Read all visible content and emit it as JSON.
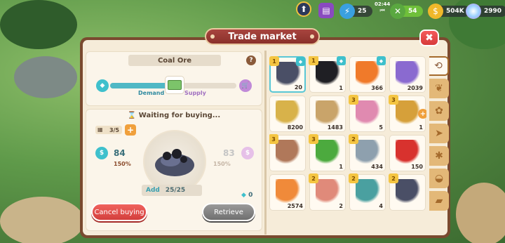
{
  "hud": {
    "level_icon": "rank-icon",
    "energy": "25",
    "timer": "02:44",
    "stamina": "54",
    "coins": "504K",
    "gems": "2990"
  },
  "window": {
    "title": "Trade market",
    "close_icon": "close-icon"
  },
  "item": {
    "name": "Coal Ore",
    "demand_label": "Demand",
    "supply_label": "Supply",
    "demand_supply_balance": 0.5
  },
  "status": {
    "waiting_text": "Waiting for buying...",
    "slots": "3/5",
    "buy_price": "84",
    "buy_pct": "150%",
    "sell_price": "83",
    "sell_pct": "150%",
    "add_label": "Add",
    "add_value": "25/25",
    "cube_count": "0"
  },
  "buttons": {
    "cancel": "Cancel buying",
    "retrieve": "Retrieve"
  },
  "grid": [
    {
      "name": "coal-ore",
      "qty": "20",
      "star": "1",
      "cube": true,
      "selected": true,
      "color": "#4a4f66"
    },
    {
      "name": "coal",
      "qty": "1",
      "star": "1",
      "cube": true,
      "color": "#1f1f24"
    },
    {
      "name": "carrot",
      "qty": "366",
      "star": "",
      "cube": true,
      "color": "#f07a2a"
    },
    {
      "name": "purple-log",
      "qty": "2039",
      "star": "",
      "cube": false,
      "color": "#8a6ad0"
    },
    {
      "name": "corn",
      "qty": "8200",
      "star": "",
      "cube": false,
      "color": "#d8b24a"
    },
    {
      "name": "pinecone",
      "qty": "1483",
      "star": "",
      "cube": false,
      "color": "#c9a46a"
    },
    {
      "name": "pink-flower",
      "qty": "5",
      "star": "3",
      "cube": false,
      "color": "#e08ab0"
    },
    {
      "name": "striped-fish",
      "qty": "1",
      "star": "3",
      "cube": false,
      "plus": true,
      "color": "#d6a03a"
    },
    {
      "name": "moth",
      "qty": "",
      "star": "3",
      "cube": false,
      "color": "#b0785a"
    },
    {
      "name": "green-butterfly",
      "qty": "1",
      "star": "3",
      "cube": false,
      "color": "#4caa3e"
    },
    {
      "name": "grey-fish",
      "qty": "434",
      "star": "2",
      "cube": false,
      "color": "#8ea0ae"
    },
    {
      "name": "apple",
      "qty": "150",
      "star": "",
      "cube": false,
      "color": "#d8322e"
    },
    {
      "name": "carrots",
      "qty": "2574",
      "star": "",
      "cube": false,
      "color": "#f08a3a"
    },
    {
      "name": "red-fish",
      "qty": "2",
      "star": "2",
      "cube": false,
      "color": "#e08a7a"
    },
    {
      "name": "teal-fish",
      "qty": "4",
      "star": "2",
      "cube": false,
      "color": "#4aa0a0"
    },
    {
      "name": "coal-ore-2",
      "qty": "",
      "star": "2",
      "cube": false,
      "color": "#4a4f66"
    }
  ],
  "side_tabs": [
    {
      "icon": "history-icon",
      "active": true
    },
    {
      "icon": "crop-icon"
    },
    {
      "icon": "seed-icon"
    },
    {
      "icon": "fish-icon"
    },
    {
      "icon": "bug-icon"
    },
    {
      "icon": "shell-icon"
    },
    {
      "icon": "ore-icon"
    }
  ],
  "colors": {
    "accent": "#4fb8c5",
    "frame": "#7a4a2f",
    "title": "#a8453f"
  }
}
